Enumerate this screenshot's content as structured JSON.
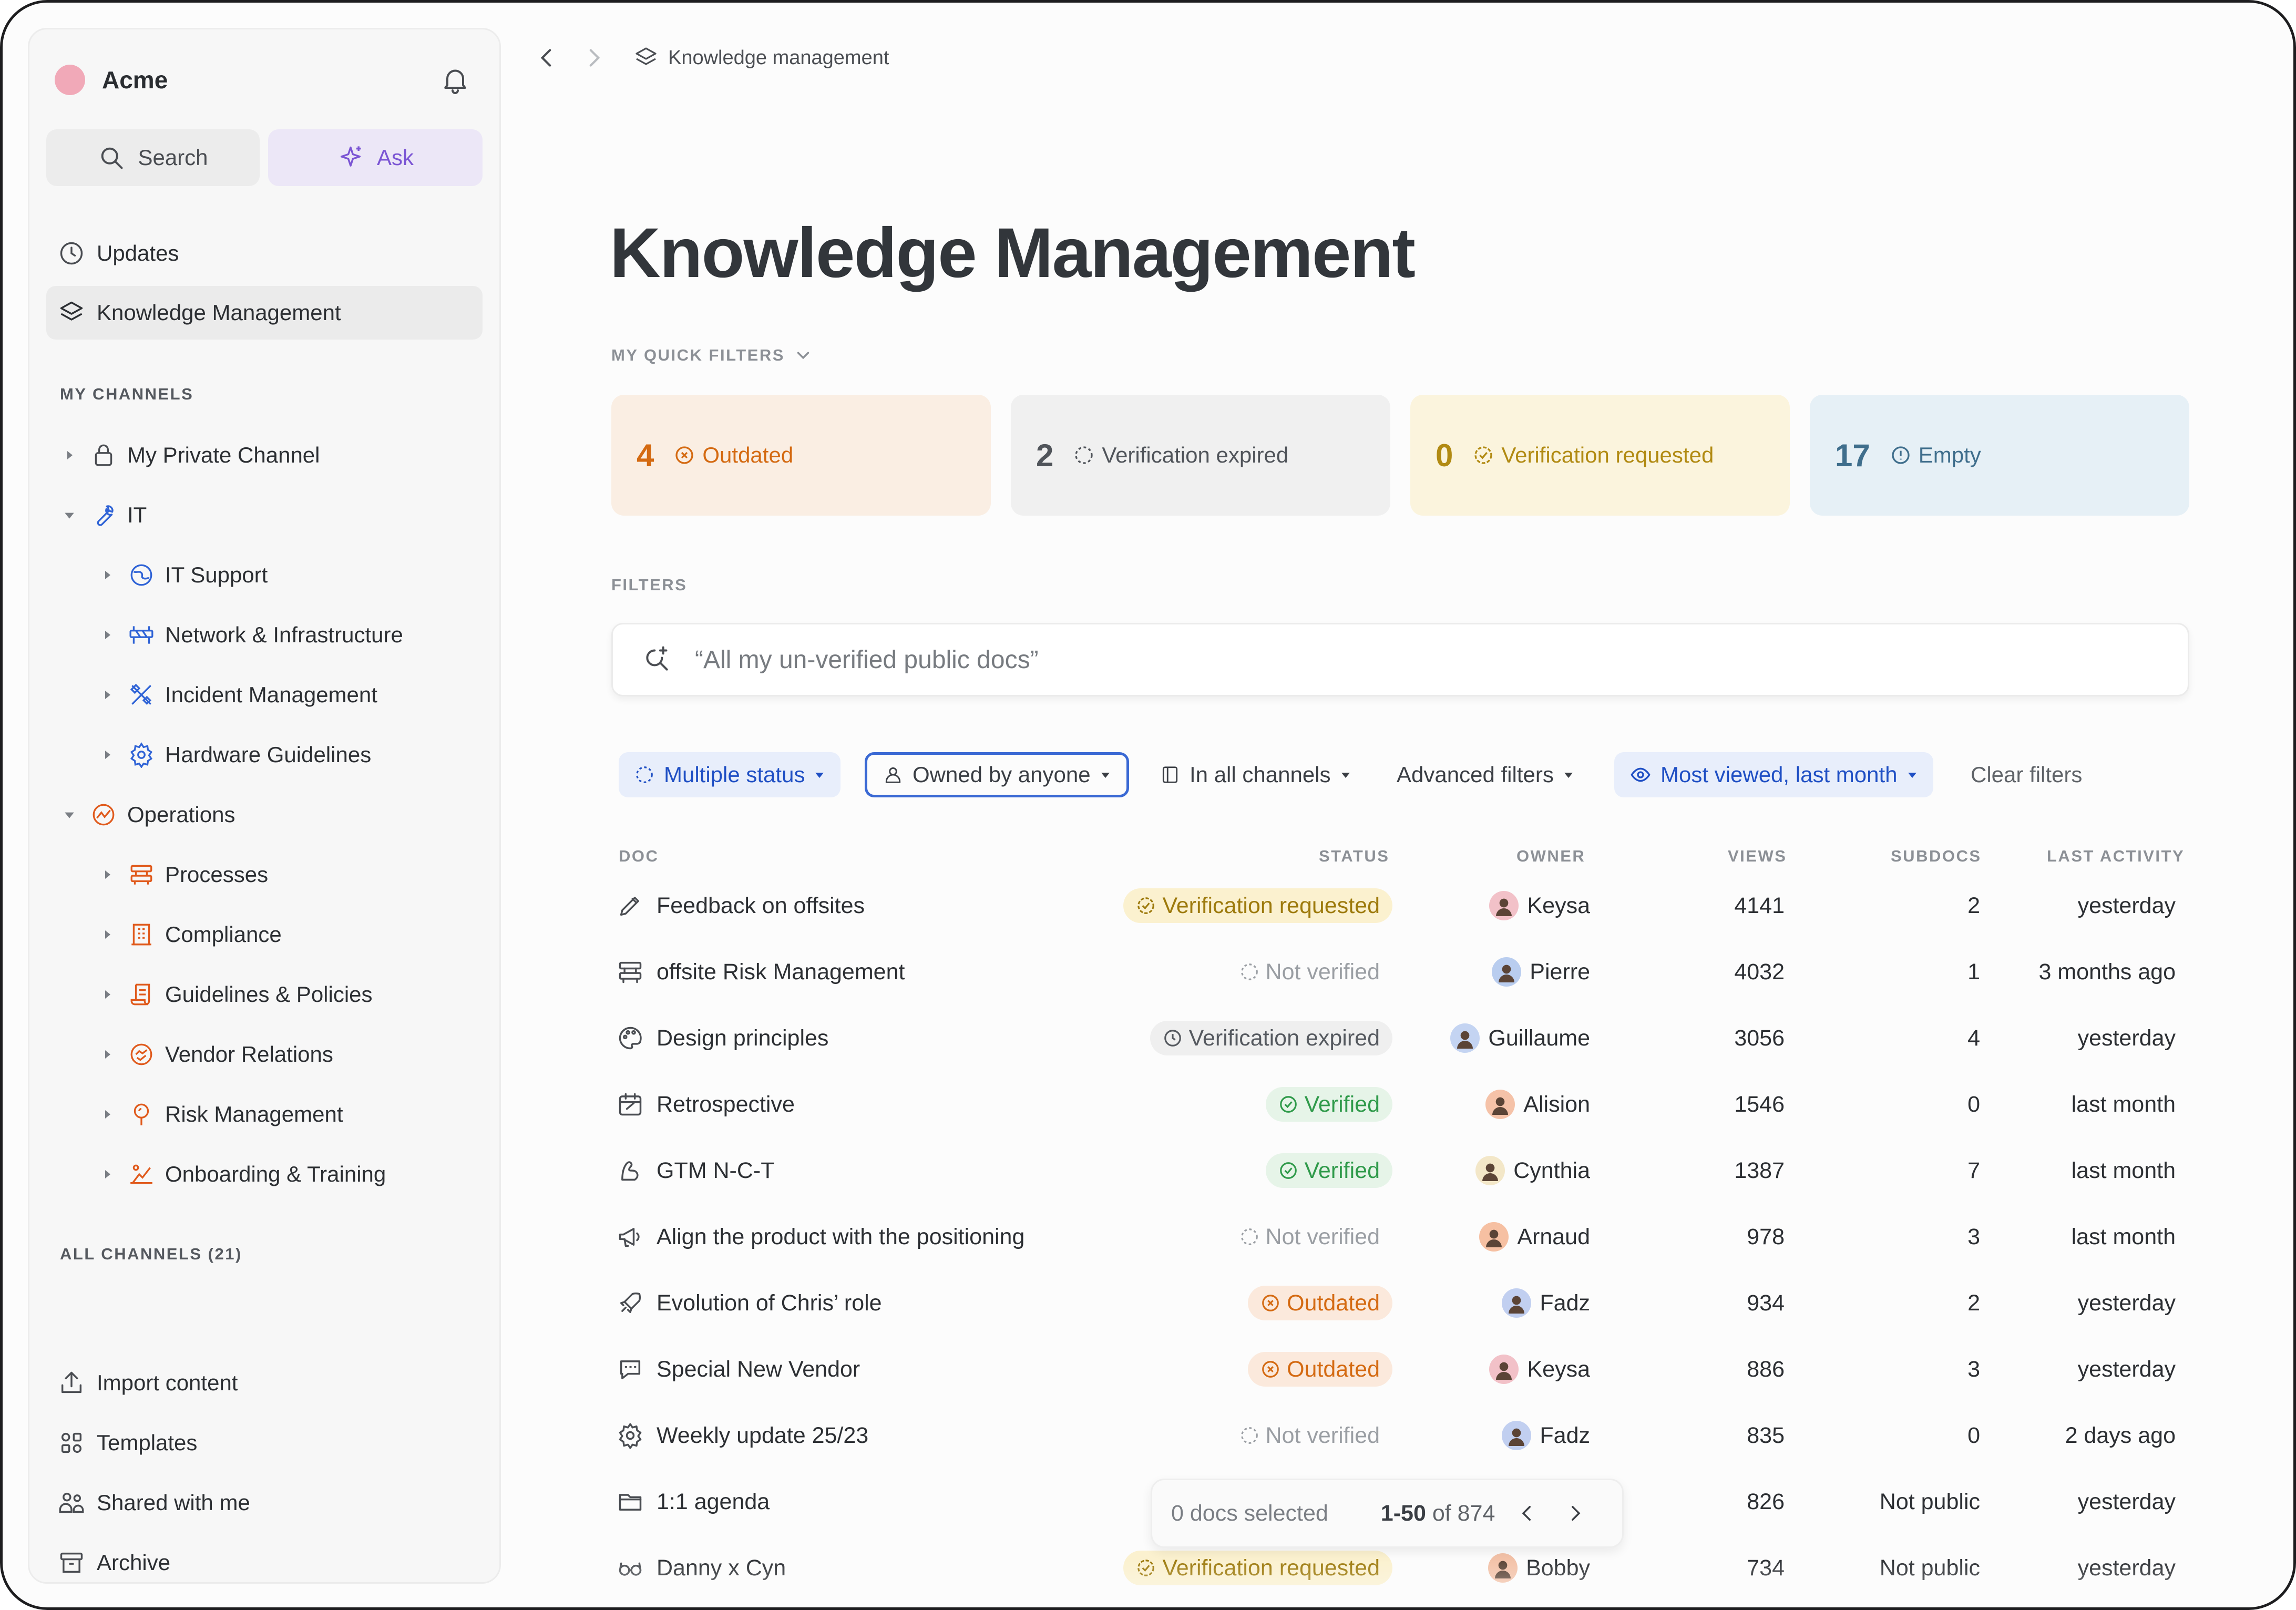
{
  "sidebar": {
    "brand": "Acme",
    "search_label": "Search",
    "ask_label": "Ask",
    "nav": [
      {
        "label": "Updates",
        "icon": "clock-icon"
      },
      {
        "label": "Knowledge Management",
        "icon": "layers-icon"
      }
    ],
    "my_channels_label": "MY CHANNELS",
    "channels": [
      {
        "label": "My Private Channel",
        "icon": "lock-icon"
      },
      {
        "label": "IT",
        "icon": "wrench-icon"
      },
      {
        "label": "IT Support",
        "icon": "globe-icon"
      },
      {
        "label": "Network & Infrastructure",
        "icon": "barrier-icon"
      },
      {
        "label": "Incident Management",
        "icon": "tools-icon"
      },
      {
        "label": "Hardware Guidelines",
        "icon": "cog-icon"
      },
      {
        "label": "Operations",
        "icon": "ops-icon"
      },
      {
        "label": "Processes",
        "icon": "process-icon"
      },
      {
        "label": "Compliance",
        "icon": "building-icon"
      },
      {
        "label": "Guidelines & Policies",
        "icon": "scroll-icon"
      },
      {
        "label": "Vendor Relations",
        "icon": "handshake-icon"
      },
      {
        "label": "Risk Management",
        "icon": "pin-icon"
      },
      {
        "label": "Onboarding & Training",
        "icon": "training-icon"
      }
    ],
    "all_channels_label": "ALL CHANNELS (21)",
    "bottom": [
      {
        "label": "Import content",
        "icon": "upload-icon"
      },
      {
        "label": "Templates",
        "icon": "grid-icon"
      },
      {
        "label": "Shared with me",
        "icon": "people-icon"
      },
      {
        "label": "Archive",
        "icon": "archive-icon"
      }
    ]
  },
  "breadcrumb": {
    "label": "Knowledge management"
  },
  "page_title": "Knowledge Management",
  "quick_filters": {
    "label": "MY QUICK FILTERS",
    "cards": [
      {
        "count": "4",
        "label": "Outdated",
        "bg": "#faeee3",
        "color": "#d46a12"
      },
      {
        "count": "2",
        "label": "Verification expired",
        "bg": "#f0f0f0",
        "color": "#50545a"
      },
      {
        "count": "0",
        "label": "Verification requested",
        "bg": "#fbf4dd",
        "color": "#b18a12"
      },
      {
        "count": "17",
        "label": "Empty",
        "bg": "#e6f0f6",
        "color": "#3f6e8c"
      }
    ]
  },
  "filters": {
    "label": "FILTERS",
    "search_placeholder": "“All my un-verified public docs”",
    "chips": {
      "status": "Multiple status",
      "owner": "Owned by anyone",
      "channels": "In all channels",
      "advanced": "Advanced filters",
      "sort": "Most viewed, last month",
      "clear": "Clear filters"
    }
  },
  "table": {
    "headers": {
      "doc": "DOC",
      "status": "STATUS",
      "owner": "OWNER",
      "views": "VIEWS",
      "subdocs": "SUBDOCS",
      "last_activity": "LAST ACTIVITY"
    },
    "rows": [
      {
        "doc": "Feedback on offsites",
        "icon": "pen-icon",
        "status": "Verification requested",
        "status_kind": "requested",
        "owner": "Keysa",
        "avatar": "#f2c1c8",
        "views": "4141",
        "subdocs": "2",
        "last": "yesterday"
      },
      {
        "doc": "offsite Risk Management",
        "icon": "process-icon",
        "status": "Not verified",
        "status_kind": "none",
        "owner": "Pierre",
        "avatar": "#b9cdef",
        "views": "4032",
        "subdocs": "1",
        "last": "3 months ago"
      },
      {
        "doc": "Design principles",
        "icon": "palette-icon",
        "status": "Verification expired",
        "status_kind": "expired",
        "owner": "Guillaume",
        "avatar": "#c4d4f2",
        "views": "3056",
        "subdocs": "4",
        "last": "yesterday"
      },
      {
        "doc": "Retrospective",
        "icon": "calendar-icon",
        "status": "Verified",
        "status_kind": "verified",
        "owner": "Alision",
        "avatar": "#f5c2a8",
        "views": "1546",
        "subdocs": "0",
        "last": "last month"
      },
      {
        "doc": "GTM N-C-T",
        "icon": "arm-icon",
        "status": "Verified",
        "status_kind": "verified",
        "owner": "Cynthia",
        "avatar": "#f3e7c8",
        "views": "1387",
        "subdocs": "7",
        "last": "last month"
      },
      {
        "doc": "Align the product with the positioning",
        "icon": "megaphone-icon",
        "status": "Not verified",
        "status_kind": "none",
        "owner": "Arnaud",
        "avatar": "#f6c0a2",
        "views": "978",
        "subdocs": "3",
        "last": "last month"
      },
      {
        "doc": "Evolution of Chris’ role",
        "icon": "rocket-icon",
        "status": "Outdated",
        "status_kind": "outdated",
        "owner": "Fadz",
        "avatar": "#c1cff0",
        "views": "934",
        "subdocs": "2",
        "last": "yesterday"
      },
      {
        "doc": "Special New Vendor",
        "icon": "chat-icon",
        "status": "Outdated",
        "status_kind": "outdated",
        "owner": "Keysa",
        "avatar": "#f2c1c8",
        "views": "886",
        "subdocs": "3",
        "last": "yesterday"
      },
      {
        "doc": "Weekly update 25/23",
        "icon": "cog-icon",
        "status": "Not verified",
        "status_kind": "none",
        "owner": "Fadz",
        "avatar": "#c1cff0",
        "views": "835",
        "subdocs": "0",
        "last": "2 days ago"
      },
      {
        "doc": "1:1 agenda",
        "icon": "folder-icon",
        "status": "",
        "status_kind": "hidden",
        "owner": "",
        "avatar": "",
        "views": "826",
        "subdocs": "Not public",
        "last": "yesterday"
      },
      {
        "doc": "Danny x Cyn",
        "icon": "glasses-icon",
        "status": "Verification requested",
        "status_kind": "requested",
        "owner": "Bobby",
        "avatar": "#f3c2a8",
        "views": "734",
        "subdocs": "Not public",
        "last": "yesterday"
      }
    ]
  },
  "footer": {
    "selected": "0 docs selected",
    "range": "1-50",
    "of_label": "of 874"
  },
  "colors": {
    "accent_blue": "#1f4fc4",
    "ask_purple": "#7b55d4",
    "verified_green": "#2f9a4a",
    "outdated_orange": "#d46a12",
    "requested_yellow": "#b18a12"
  }
}
